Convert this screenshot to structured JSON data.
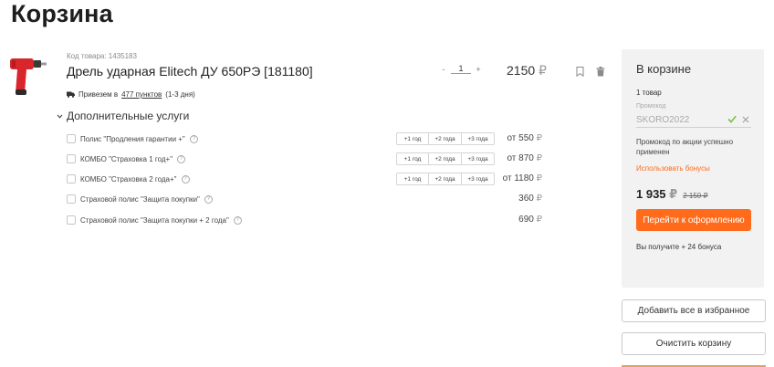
{
  "page": {
    "title": "Корзина"
  },
  "product": {
    "sku": "Код товара: 1435183",
    "name": "Дрель ударная Elitech ДУ 650РЭ [181180]",
    "delivery_prefix": "Привезем в",
    "delivery_link": "477 пунктов",
    "delivery_suffix": "(1-3 дня)",
    "qty_minus": "-",
    "qty_value": "1",
    "qty_plus": "+",
    "price": "2150",
    "currency": "₽"
  },
  "services": {
    "heading": "Дополнительные услуги",
    "rows": [
      {
        "label": "Полис \"Продления гарантии +\"",
        "years": [
          "+1 год",
          "+2 года",
          "+3 года"
        ],
        "price": "от 550"
      },
      {
        "label": "КОМБО \"Страховка 1 год+\"",
        "years": [
          "+1 год",
          "+2 года",
          "+3 года"
        ],
        "price": "от 870"
      },
      {
        "label": "КОМБО \"Страховка 2 года+\"",
        "years": [
          "+1 год",
          "+2 года",
          "+3 года"
        ],
        "price": "от 1180"
      },
      {
        "label": "Страховой полис \"Защита покупки\"",
        "price": "360"
      },
      {
        "label": "Страховой полис \"Защита покупки + 2 года\"",
        "price": "690"
      }
    ],
    "help_glyph": "?"
  },
  "summary": {
    "title": "В корзине",
    "count": "1 товар",
    "promo_label": "Промокод",
    "promo_value": "SKORO2022",
    "promo_note": "Промокод по акции успешно применен",
    "bonus_link": "Использовать бонусы",
    "total": "1 935",
    "old_total": "2 150",
    "checkout": "Перейти к оформлению",
    "bonus_text": "Вы получите + 24 бонуса"
  },
  "actions": {
    "add_all_favorites": "Добавить все в избранное",
    "clear_cart": "Очистить корзину"
  },
  "colors": {
    "accent": "#ff6b1a",
    "panel": "#f2f2f2",
    "check": "#7dc242"
  },
  "icons": [
    "drill-image",
    "truck-icon",
    "bookmark-icon",
    "trash-icon",
    "chevron-down-icon",
    "help-icon",
    "check-icon",
    "close-icon"
  ]
}
